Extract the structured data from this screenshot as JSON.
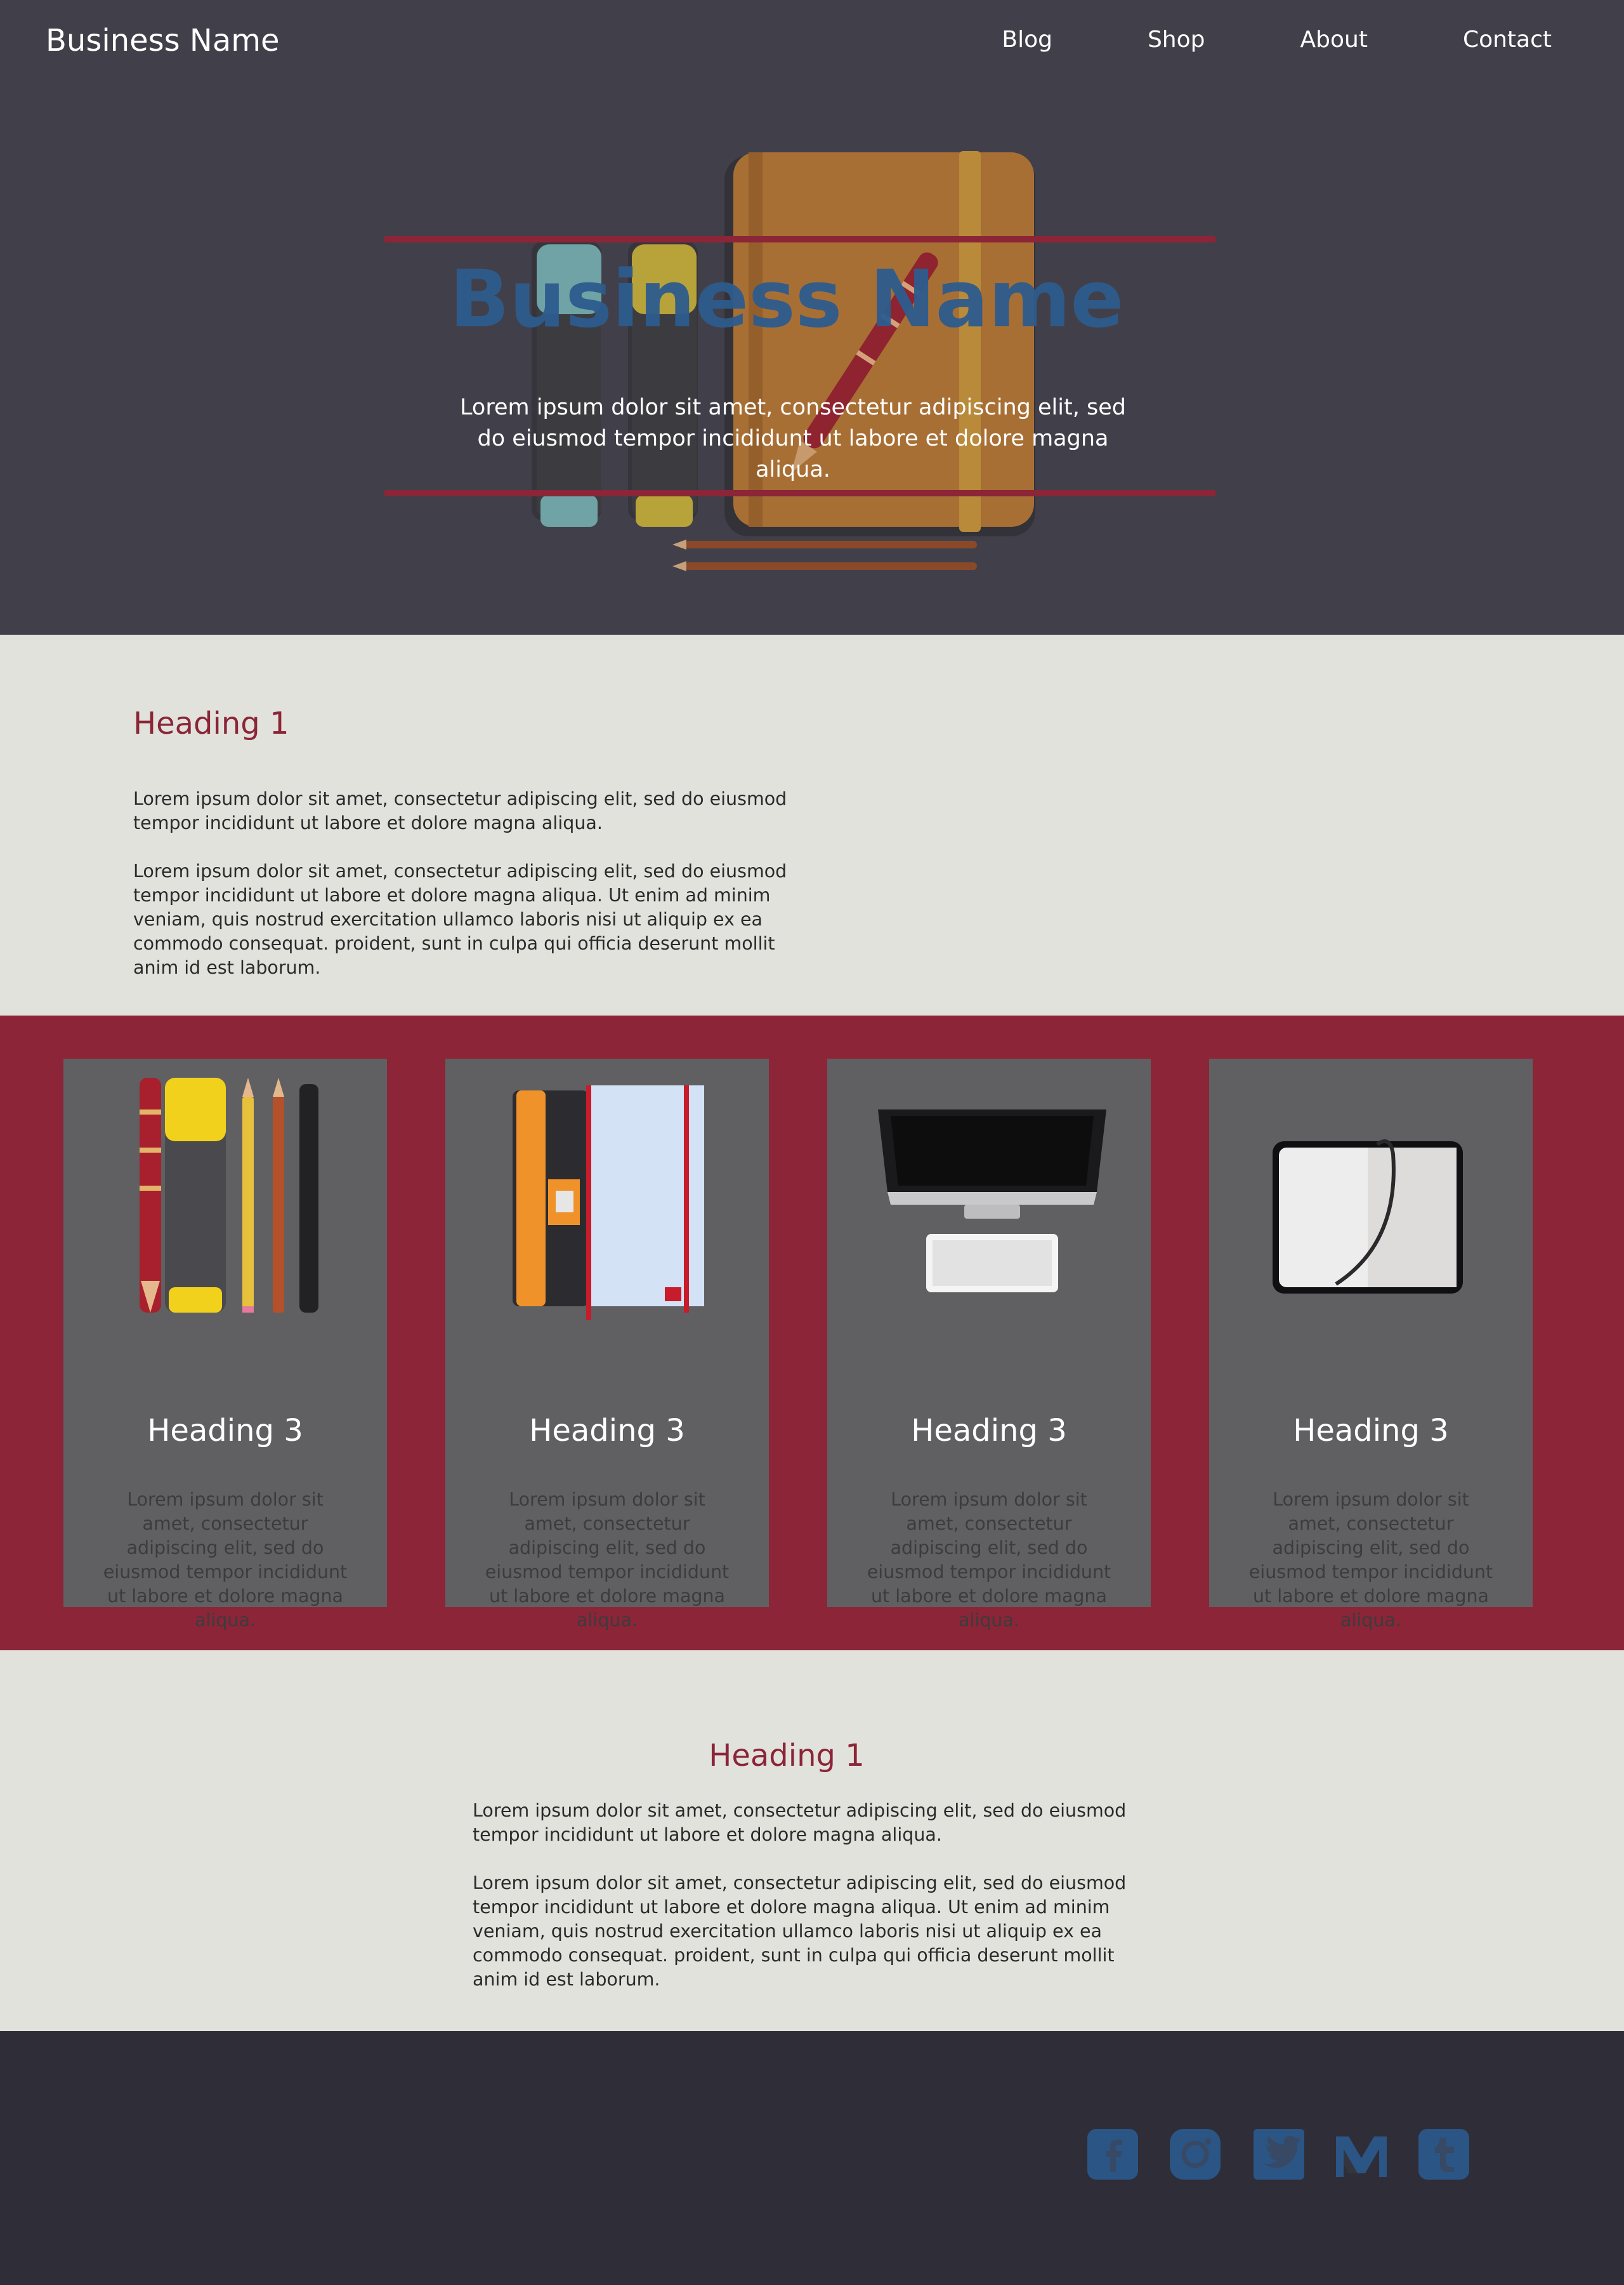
{
  "nav": {
    "brand": "Business Name",
    "links": [
      "Blog",
      "Shop",
      "About",
      "Contact"
    ]
  },
  "hero": {
    "title": "Business Name",
    "subtitle": "Lorem ipsum dolor sit amet, consectetur adipiscing elit, sed do eiusmod tempor incididunt ut labore et dolore magna aliqua."
  },
  "section1": {
    "heading": "Heading 1",
    "paragraphs": [
      "Lorem ipsum dolor sit amet, consectetur adipiscing elit, sed do eiusmod tempor incididunt ut labore et dolore magna aliqua.",
      "Lorem ipsum dolor sit amet, consectetur adipiscing elit, sed do eiusmod tempor incididunt ut labore et dolore magna aliqua. Ut enim ad minim veniam, quis nostrud exercitation ullamco laboris nisi ut aliquip ex ea commodo consequat. proident, sunt in culpa qui officia deserunt mollit anim id est laborum."
    ]
  },
  "cards": [
    {
      "icon": "pens-pencils-icon",
      "title": "Heading 3",
      "text": "Lorem ipsum dolor sit amet, consectetur adipiscing elit, sed do eiusmod tempor incididunt ut labore et dolore magna aliqua."
    },
    {
      "icon": "notebooks-icon",
      "title": "Heading 3",
      "text": "Lorem ipsum dolor sit amet, consectetur adipiscing elit, sed do eiusmod tempor incididunt ut labore et dolore magna aliqua."
    },
    {
      "icon": "computer-icon",
      "title": "Heading 3",
      "text": "Lorem ipsum dolor sit amet, consectetur adipiscing elit, sed do eiusmod tempor incididunt ut labore et dolore magna aliqua."
    },
    {
      "icon": "tablet-icon",
      "title": "Heading 3",
      "text": "Lorem ipsum dolor sit amet, consectetur adipiscing elit, sed do eiusmod tempor incididunt ut labore et dolore magna aliqua."
    }
  ],
  "section2": {
    "heading": "Heading 1",
    "paragraphs": [
      "Lorem ipsum dolor sit amet, consectetur adipiscing elit, sed do eiusmod tempor incididunt ut labore et dolore magna aliqua.",
      "Lorem ipsum dolor sit amet, consectetur adipiscing elit, sed do eiusmod tempor incididunt ut labore et dolore magna aliqua. Ut enim ad minim veniam, quis nostrud exercitation ullamco laboris nisi ut aliquip ex ea commodo consequat. proident, sunt in culpa qui officia deserunt mollit anim id est laborum."
    ]
  },
  "footer": {
    "social_icons": [
      "facebook-icon",
      "instagram-icon",
      "twitter-icon",
      "medium-icon",
      "tumblr-icon"
    ]
  },
  "colors": {
    "nav_bg": "#41404a",
    "accent": "#8b2537",
    "hero_title": "#2d5c8e",
    "light_bg": "#e2e2dd",
    "card_bg": "#606063",
    "footer_bg": "#2e2d38",
    "social": "#2b5584"
  }
}
